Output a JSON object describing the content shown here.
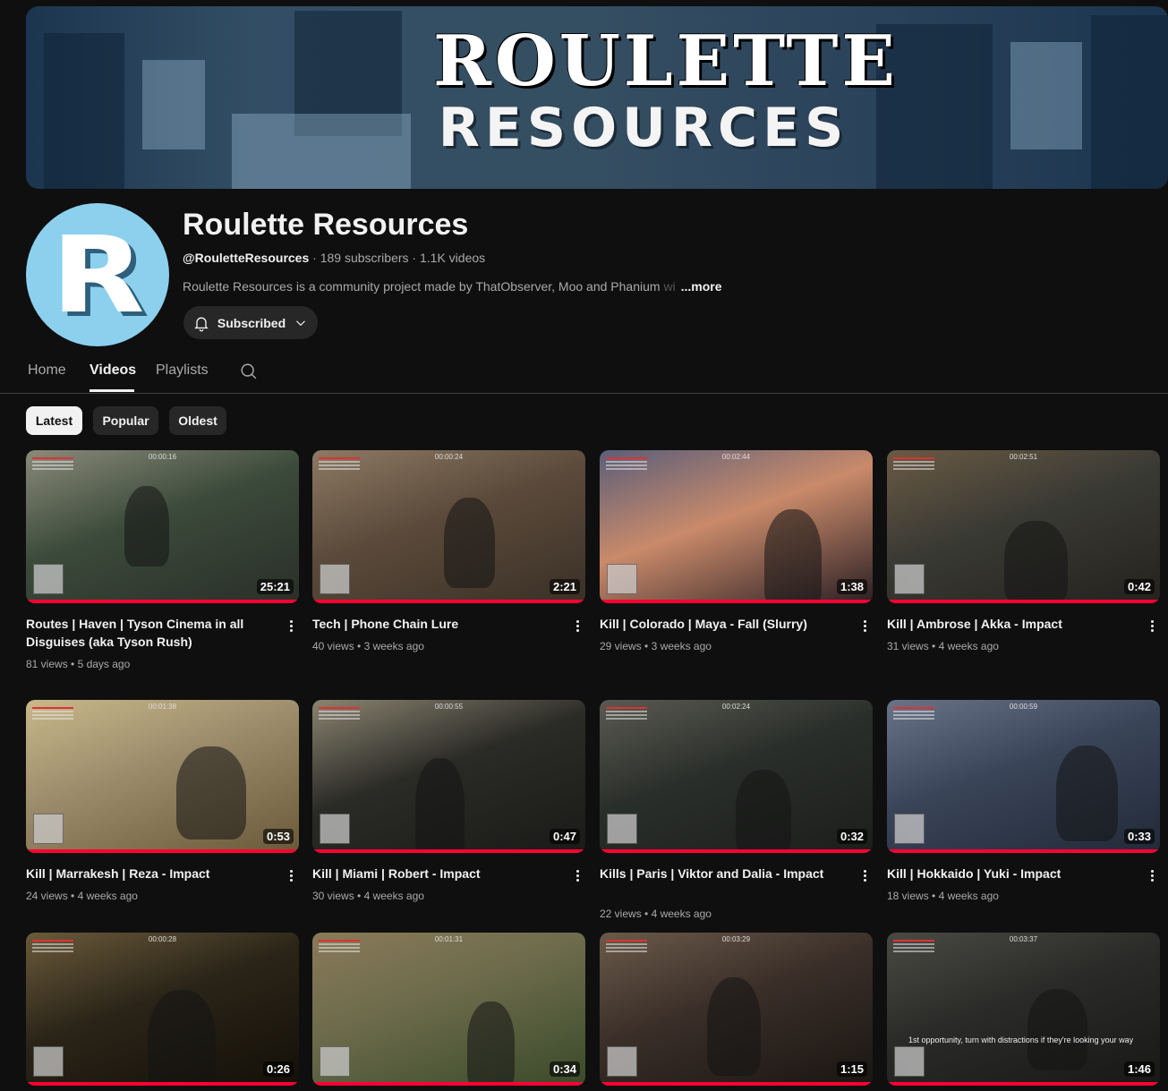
{
  "banner": {
    "title_line1": "ROULETTE",
    "title_line2": "RESOURCES"
  },
  "channel": {
    "avatar_letter": "R",
    "name": "Roulette Resources",
    "handle": "@RouletteResources",
    "subscribers": "189 subscribers",
    "videos": "1.1K videos",
    "description": "Roulette Resources is a community project made by ThatObserver, Moo and Phanium",
    "description_fade": " wi",
    "more": "...more",
    "subscribe_label": "Subscribed"
  },
  "tabs": [
    "Home",
    "Videos",
    "Playlists"
  ],
  "chips": [
    "Latest",
    "Popular",
    "Oldest"
  ],
  "videos": [
    {
      "title": "Routes | Haven | Tyson Cinema in all Disguises (aka Tyson Rush)",
      "views": "81 views",
      "age": "5 days ago",
      "duration": "25:21",
      "timer": "00:00:16",
      "caption": ""
    },
    {
      "title": "Tech | Phone Chain Lure",
      "views": "40 views",
      "age": "3 weeks ago",
      "duration": "2:21",
      "timer": "00:00:24",
      "caption": ""
    },
    {
      "title": "Kill | Colorado | Maya - Fall (Slurry)",
      "views": "29 views",
      "age": "3 weeks ago",
      "duration": "1:38",
      "timer": "00:02:44",
      "caption": ""
    },
    {
      "title": "Kill | Ambrose | Akka - Impact",
      "views": "31 views",
      "age": "4 weeks ago",
      "duration": "0:42",
      "timer": "00:02:51",
      "caption": ""
    },
    {
      "title": "Kill | Marrakesh | Reza - Impact",
      "views": "24 views",
      "age": "4 weeks ago",
      "duration": "0:53",
      "timer": "00:01:38",
      "caption": ""
    },
    {
      "title": "Kill | Miami | Robert - Impact",
      "views": "30 views",
      "age": "4 weeks ago",
      "duration": "0:47",
      "timer": "00:00:55",
      "caption": ""
    },
    {
      "title": "Kills | Paris | Viktor and Dalia - Impact",
      "views": "22 views",
      "age": "4 weeks ago",
      "duration": "0:32",
      "timer": "00:02:24",
      "caption": ""
    },
    {
      "title": "Kill | Hokkaido | Yuki - Impact",
      "views": "18 views",
      "age": "4 weeks ago",
      "duration": "0:33",
      "timer": "00:00:59",
      "caption": ""
    },
    {
      "title": "",
      "views": "",
      "age": "",
      "duration": "0:26",
      "timer": "00:00:28",
      "caption": ""
    },
    {
      "title": "",
      "views": "",
      "age": "",
      "duration": "0:34",
      "timer": "00:01:31",
      "caption": ""
    },
    {
      "title": "",
      "views": "",
      "age": "",
      "duration": "1:15",
      "timer": "00:03:29",
      "caption": ""
    },
    {
      "title": "",
      "views": "",
      "age": "",
      "duration": "1:46",
      "timer": "00:03:37",
      "caption": "1st opportunity, turn with distractions if they're looking your way"
    }
  ],
  "colors": {
    "accent": "#ff0033",
    "avatar_bg": "#8cd0ee",
    "background": "#0f0f0f"
  },
  "icons": {
    "subscribe": "bell-icon",
    "subscribe_menu": "chevron-down-icon",
    "search": "search-icon",
    "menu": "more-vert-icon"
  }
}
